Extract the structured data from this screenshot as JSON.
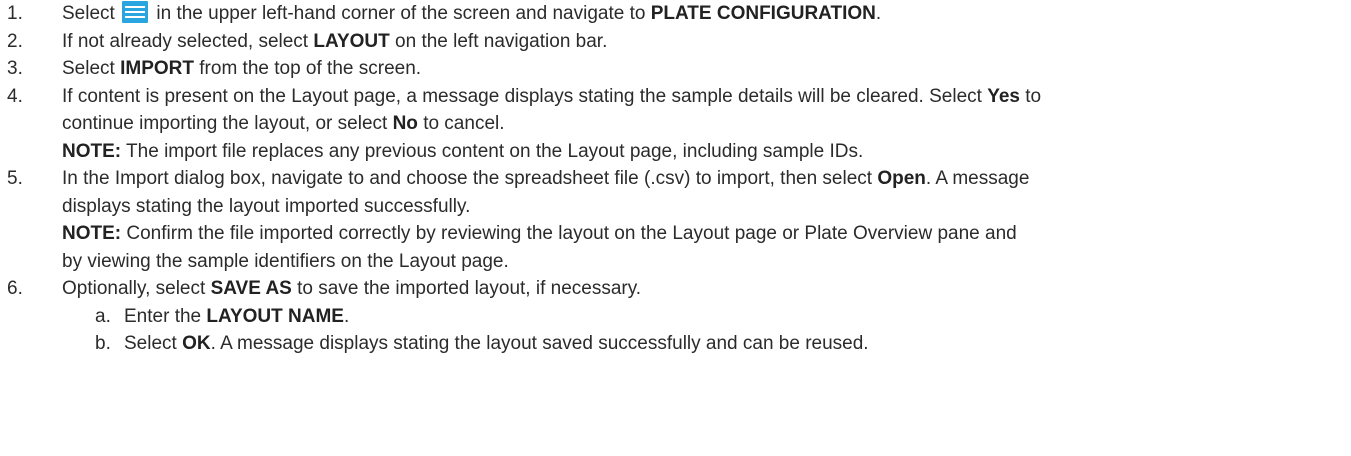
{
  "steps": [
    {
      "num": "1.",
      "t1": "Select",
      "icon": "hamburger-menu-icon",
      "t2": "in the upper left-hand corner of the screen and navigate to",
      "b1": "PLATE CONFIGURATION",
      "t3": "."
    },
    {
      "num": "2.",
      "t1": "If not already selected, select",
      "b1": "LAYOUT",
      "t2": "on the left navigation bar."
    },
    {
      "num": "3.",
      "t1": "Select",
      "b1": "IMPORT",
      "t2": "from the top of the screen."
    },
    {
      "num": "4.",
      "t1": "If content is present on the Layout page, a message displays stating the sample details will be cleared. Select",
      "b1": "Yes",
      "t2": "to",
      "t3": "continue importing the layout, or select",
      "b2": "No",
      "t4": "to cancel.",
      "note_label": "NOTE:",
      "note_text": "The import file replaces any previous content on the Layout page, including sample IDs."
    },
    {
      "num": "5.",
      "t1": "In the Import dialog box, navigate to and choose the spreadsheet file (.csv) to import, then select",
      "b1": "Open",
      "t2": ". A message",
      "t3": "displays stating the layout imported successfully.",
      "note_label": "NOTE:",
      "note_text1": "Confirm the file imported correctly by reviewing the layout on the Layout page or Plate Overview pane and",
      "note_text2": "by viewing the sample identifiers on the Layout page."
    },
    {
      "num": "6.",
      "t1": "Optionally, select",
      "b1": "SAVE AS",
      "t2": "to save the imported layout, if necessary.",
      "subs": [
        {
          "letter": "a.",
          "t1": "Enter the",
          "b1": "LAYOUT NAME",
          "t2": "."
        },
        {
          "letter": "b.",
          "t1": "Select",
          "b1": "OK",
          "t2": ". A message displays stating the layout saved successfully and can be reused."
        }
      ]
    }
  ]
}
